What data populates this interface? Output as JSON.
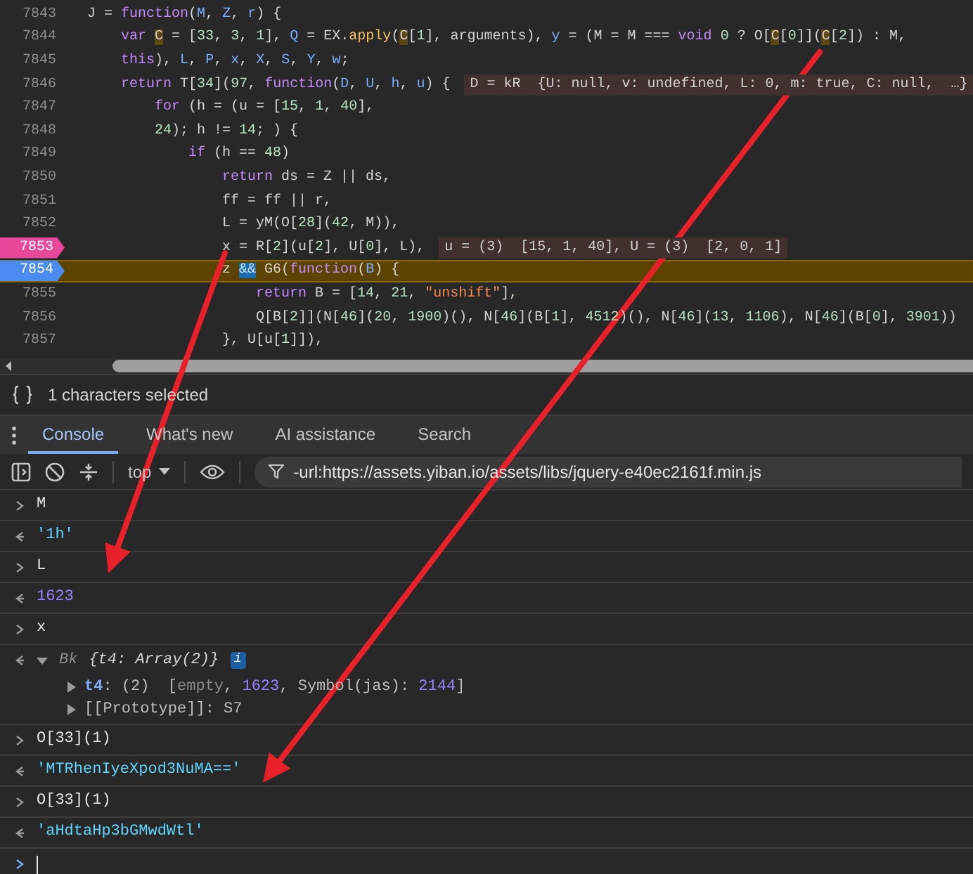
{
  "code_lines": [
    {
      "number": "7843",
      "breakpoint": false,
      "paused": false,
      "tokens": [
        {
          "text": "J = ",
          "kind": "plain"
        },
        {
          "text": "function",
          "kind": "keyword"
        },
        {
          "text": "(",
          "kind": "plain"
        },
        {
          "text": "M",
          "kind": "param"
        },
        {
          "text": ", ",
          "kind": "plain"
        },
        {
          "text": "Z",
          "kind": "param"
        },
        {
          "text": ", ",
          "kind": "plain"
        },
        {
          "text": "r",
          "kind": "param"
        },
        {
          "text": ") {",
          "kind": "plain"
        }
      ],
      "children": [
        {
          "number": "7844",
          "breakpoint": false,
          "paused": false,
          "tokens": [
            {
              "text": "var ",
              "kind": "keyword"
            },
            {
              "text": "C",
              "kind": "match"
            },
            {
              "text": " = [",
              "kind": "plain"
            },
            {
              "text": "33",
              "kind": "number"
            },
            {
              "text": ", ",
              "kind": "plain"
            },
            {
              "text": "3",
              "kind": "number"
            },
            {
              "text": ", ",
              "kind": "plain"
            },
            {
              "text": "1",
              "kind": "number"
            },
            {
              "text": "], ",
              "kind": "plain"
            },
            {
              "text": "Q",
              "kind": "param"
            },
            {
              "text": " = EX.",
              "kind": "plain"
            },
            {
              "text": "apply",
              "kind": "method"
            },
            {
              "text": "(",
              "kind": "plain"
            },
            {
              "text": "C",
              "kind": "match"
            },
            {
              "text": "[",
              "kind": "plain"
            },
            {
              "text": "1",
              "kind": "number"
            },
            {
              "text": "], arguments), ",
              "kind": "plain"
            },
            {
              "text": "y",
              "kind": "param"
            },
            {
              "text": " = (M = M === ",
              "kind": "plain"
            },
            {
              "text": "void ",
              "kind": "keyword"
            },
            {
              "text": "0",
              "kind": "number"
            },
            {
              "text": " ? O[",
              "kind": "plain"
            },
            {
              "text": "C",
              "kind": "match"
            },
            {
              "text": "[",
              "kind": "plain"
            },
            {
              "text": "0",
              "kind": "number"
            },
            {
              "text": "]](",
              "kind": "plain"
            },
            {
              "text": "C",
              "kind": "match"
            },
            {
              "text": "[",
              "kind": "plain"
            },
            {
              "text": "2",
              "kind": "number"
            },
            {
              "text": "]) : M,",
              "kind": "plain"
            }
          ]
        },
        {
          "number": "7845",
          "breakpoint": false,
          "paused": false,
          "tokens": [
            {
              "text": "this",
              "kind": "keyword"
            },
            {
              "text": "), ",
              "kind": "plain"
            },
            {
              "text": "L",
              "kind": "param"
            },
            {
              "text": ", ",
              "kind": "plain"
            },
            {
              "text": "P",
              "kind": "param"
            },
            {
              "text": ", ",
              "kind": "plain"
            },
            {
              "text": "x",
              "kind": "param"
            },
            {
              "text": ", ",
              "kind": "plain"
            },
            {
              "text": "X",
              "kind": "param"
            },
            {
              "text": ", ",
              "kind": "plain"
            },
            {
              "text": "S",
              "kind": "param"
            },
            {
              "text": ", ",
              "kind": "plain"
            },
            {
              "text": "Y",
              "kind": "param"
            },
            {
              "text": ", ",
              "kind": "plain"
            },
            {
              "text": "w",
              "kind": "param"
            },
            {
              "text": ";",
              "kind": "plain"
            }
          ]
        },
        {
          "number": "7846",
          "breakpoint": false,
          "paused": false,
          "inline_value": "D = kR  {U: null, v: undefined, L: 0, m: true, C: null,  …}",
          "tokens": [
            {
              "text": "return",
              "kind": "keyword"
            },
            {
              "text": " T[",
              "kind": "plain"
            },
            {
              "text": "34",
              "kind": "number"
            },
            {
              "text": "](",
              "kind": "plain"
            },
            {
              "text": "97",
              "kind": "number"
            },
            {
              "text": ", ",
              "kind": "plain"
            },
            {
              "text": "function",
              "kind": "keyword"
            },
            {
              "text": "(",
              "kind": "plain"
            },
            {
              "text": "D",
              "kind": "param"
            },
            {
              "text": ", ",
              "kind": "plain"
            },
            {
              "text": "U",
              "kind": "param"
            },
            {
              "text": ", ",
              "kind": "plain"
            },
            {
              "text": "h",
              "kind": "param"
            },
            {
              "text": ", ",
              "kind": "plain"
            },
            {
              "text": "u",
              "kind": "param"
            },
            {
              "text": ") {",
              "kind": "plain"
            }
          ],
          "children": [
            {
              "number": "7847",
              "breakpoint": false,
              "paused": false,
              "tokens": [
                {
                  "text": "for",
                  "kind": "keyword"
                },
                {
                  "text": " (h = (u = [",
                  "kind": "plain"
                },
                {
                  "text": "15",
                  "kind": "number"
                },
                {
                  "text": ", ",
                  "kind": "plain"
                },
                {
                  "text": "1",
                  "kind": "number"
                },
                {
                  "text": ", ",
                  "kind": "plain"
                },
                {
                  "text": "40",
                  "kind": "number"
                },
                {
                  "text": "],",
                  "kind": "plain"
                }
              ]
            },
            {
              "number": "7848",
              "breakpoint": false,
              "paused": false,
              "tokens": [
                {
                  "text": "24",
                  "kind": "number"
                },
                {
                  "text": "); h != ",
                  "kind": "plain"
                },
                {
                  "text": "14",
                  "kind": "number"
                },
                {
                  "text": "; ) {",
                  "kind": "plain"
                }
              ],
              "children": [
                {
                  "number": "7849",
                  "breakpoint": false,
                  "paused": false,
                  "tokens": [
                    {
                      "text": "if",
                      "kind": "keyword"
                    },
                    {
                      "text": " (h == ",
                      "kind": "plain"
                    },
                    {
                      "text": "48",
                      "kind": "number"
                    },
                    {
                      "text": ")",
                      "kind": "plain"
                    }
                  ],
                  "children": [
                    {
                      "number": "7850",
                      "breakpoint": false,
                      "paused": false,
                      "tokens": [
                        {
                          "text": "return",
                          "kind": "keyword"
                        },
                        {
                          "text": " ds = Z || ds,",
                          "kind": "plain"
                        }
                      ]
                    },
                    {
                      "number": "7851",
                      "breakpoint": false,
                      "paused": false,
                      "tokens": [
                        {
                          "text": "ff = ff || r,",
                          "kind": "plain"
                        }
                      ]
                    },
                    {
                      "number": "7852",
                      "breakpoint": false,
                      "paused": false,
                      "tokens": [
                        {
                          "text": "L = yM(O[",
                          "kind": "plain"
                        },
                        {
                          "text": "28",
                          "kind": "number"
                        },
                        {
                          "text": "](",
                          "kind": "plain"
                        },
                        {
                          "text": "42",
                          "kind": "number"
                        },
                        {
                          "text": ", M)),",
                          "kind": "plain"
                        }
                      ]
                    },
                    {
                      "number": "7853",
                      "breakpoint": true,
                      "logpoint": true,
                      "paused": false,
                      "inline_value": "u = (3)  [15, 1, 40], U = (3)  [2, 0, 1]",
                      "tokens": [
                        {
                          "text": "x = R[",
                          "kind": "plain"
                        },
                        {
                          "text": "2",
                          "kind": "number"
                        },
                        {
                          "text": "](u[",
                          "kind": "plain"
                        },
                        {
                          "text": "2",
                          "kind": "number"
                        },
                        {
                          "text": "], U[",
                          "kind": "plain"
                        },
                        {
                          "text": "0",
                          "kind": "number"
                        },
                        {
                          "text": "], L),",
                          "kind": "plain"
                        }
                      ]
                    },
                    {
                      "number": "7854",
                      "breakpoint": true,
                      "logpoint": false,
                      "paused": true,
                      "tokens": [
                        {
                          "text": "z ",
                          "kind": "plain"
                        },
                        {
                          "text": "&&",
                          "kind": "current"
                        },
                        {
                          "text": " G6(",
                          "kind": "plain"
                        },
                        {
                          "text": "function",
                          "kind": "keyword"
                        },
                        {
                          "text": "(",
                          "kind": "plain"
                        },
                        {
                          "text": "B",
                          "kind": "param"
                        },
                        {
                          "text": ") {",
                          "kind": "plain"
                        }
                      ],
                      "children": [
                        {
                          "number": "7855",
                          "breakpoint": false,
                          "paused": false,
                          "tokens": [
                            {
                              "text": "return",
                              "kind": "keyword"
                            },
                            {
                              "text": " B = [",
                              "kind": "plain"
                            },
                            {
                              "text": "14",
                              "kind": "number"
                            },
                            {
                              "text": ", ",
                              "kind": "plain"
                            },
                            {
                              "text": "21",
                              "kind": "number"
                            },
                            {
                              "text": ", ",
                              "kind": "plain"
                            },
                            {
                              "text": "\"unshift\"",
                              "kind": "string"
                            },
                            {
                              "text": "],",
                              "kind": "plain"
                            }
                          ]
                        },
                        {
                          "number": "7856",
                          "breakpoint": false,
                          "paused": false,
                          "tokens": [
                            {
                              "text": "Q[B[",
                              "kind": "plain"
                            },
                            {
                              "text": "2",
                              "kind": "number"
                            },
                            {
                              "text": "]](N[",
                              "kind": "plain"
                            },
                            {
                              "text": "46",
                              "kind": "number"
                            },
                            {
                              "text": "](",
                              "kind": "plain"
                            },
                            {
                              "text": "20",
                              "kind": "number"
                            },
                            {
                              "text": ", ",
                              "kind": "plain"
                            },
                            {
                              "text": "1900",
                              "kind": "number"
                            },
                            {
                              "text": ")(), N[",
                              "kind": "plain"
                            },
                            {
                              "text": "46",
                              "kind": "number"
                            },
                            {
                              "text": "](B[",
                              "kind": "plain"
                            },
                            {
                              "text": "1",
                              "kind": "number"
                            },
                            {
                              "text": "], ",
                              "kind": "plain"
                            },
                            {
                              "text": "4512",
                              "kind": "number"
                            },
                            {
                              "text": ")(), N[",
                              "kind": "plain"
                            },
                            {
                              "text": "46",
                              "kind": "number"
                            },
                            {
                              "text": "](",
                              "kind": "plain"
                            },
                            {
                              "text": "13",
                              "kind": "number"
                            },
                            {
                              "text": ", ",
                              "kind": "plain"
                            },
                            {
                              "text": "1106",
                              "kind": "number"
                            },
                            {
                              "text": "), N[",
                              "kind": "plain"
                            },
                            {
                              "text": "46",
                              "kind": "number"
                            },
                            {
                              "text": "](B[",
                              "kind": "plain"
                            },
                            {
                              "text": "0",
                              "kind": "number"
                            },
                            {
                              "text": "], ",
                              "kind": "plain"
                            },
                            {
                              "text": "3901",
                              "kind": "number"
                            },
                            {
                              "text": "))",
                              "kind": "plain"
                            }
                          ]
                        }
                      ]
                    },
                    {
                      "number": "7857",
                      "breakpoint": false,
                      "paused": false,
                      "tokens": [
                        {
                          "text": "}, U[u[",
                          "kind": "plain"
                        },
                        {
                          "text": "1",
                          "kind": "number"
                        },
                        {
                          "text": "]]),",
                          "kind": "plain"
                        }
                      ]
                    }
                  ]
                }
              ]
            }
          ]
        }
      ]
    }
  ],
  "status_bar": {
    "text": "1 characters selected"
  },
  "drawer_tabs": [
    {
      "label": "Console",
      "selected": true
    },
    {
      "label": "What's new",
      "selected": false
    },
    {
      "label": "AI assistance",
      "selected": false
    },
    {
      "label": "Search",
      "selected": false
    }
  ],
  "console_toolbar": {
    "context": "top",
    "filter": "-url:https://assets.yiban.io/assets/libs/jquery-e40ec2161f.min.js"
  },
  "console_entries": [
    {
      "kind": "command",
      "text": "M"
    },
    {
      "kind": "string",
      "text": "'1h'"
    },
    {
      "kind": "command",
      "text": "L"
    },
    {
      "kind": "number",
      "text": "1623"
    },
    {
      "kind": "command",
      "text": "x"
    },
    {
      "kind": "object",
      "class_name": "Bk",
      "summary": "{t4: Array(2)}",
      "badge": "i",
      "expanded": true,
      "properties": [
        {
          "name": "t4",
          "tokens": [
            {
              "text": ": (2)  [",
              "kind": "plain"
            },
            {
              "text": "empty",
              "kind": "muted"
            },
            {
              "text": ", ",
              "kind": "plain"
            },
            {
              "text": "1623",
              "kind": "number"
            },
            {
              "text": ", Symbol(jas): ",
              "kind": "plain"
            },
            {
              "text": "2144",
              "kind": "number"
            },
            {
              "text": "]",
              "kind": "plain"
            }
          ]
        },
        {
          "name": "[[Prototype]]",
          "tokens": [
            {
              "text": ": S7",
              "kind": "plain"
            }
          ]
        }
      ]
    },
    {
      "kind": "command",
      "text": "O[33](1)"
    },
    {
      "kind": "string",
      "text": "'MTRhenIyeXpod3NuMA=='"
    },
    {
      "kind": "command",
      "text": "O[33](1)"
    },
    {
      "kind": "string",
      "text": "'aHdtaHp3bGMwdWtl'"
    }
  ]
}
